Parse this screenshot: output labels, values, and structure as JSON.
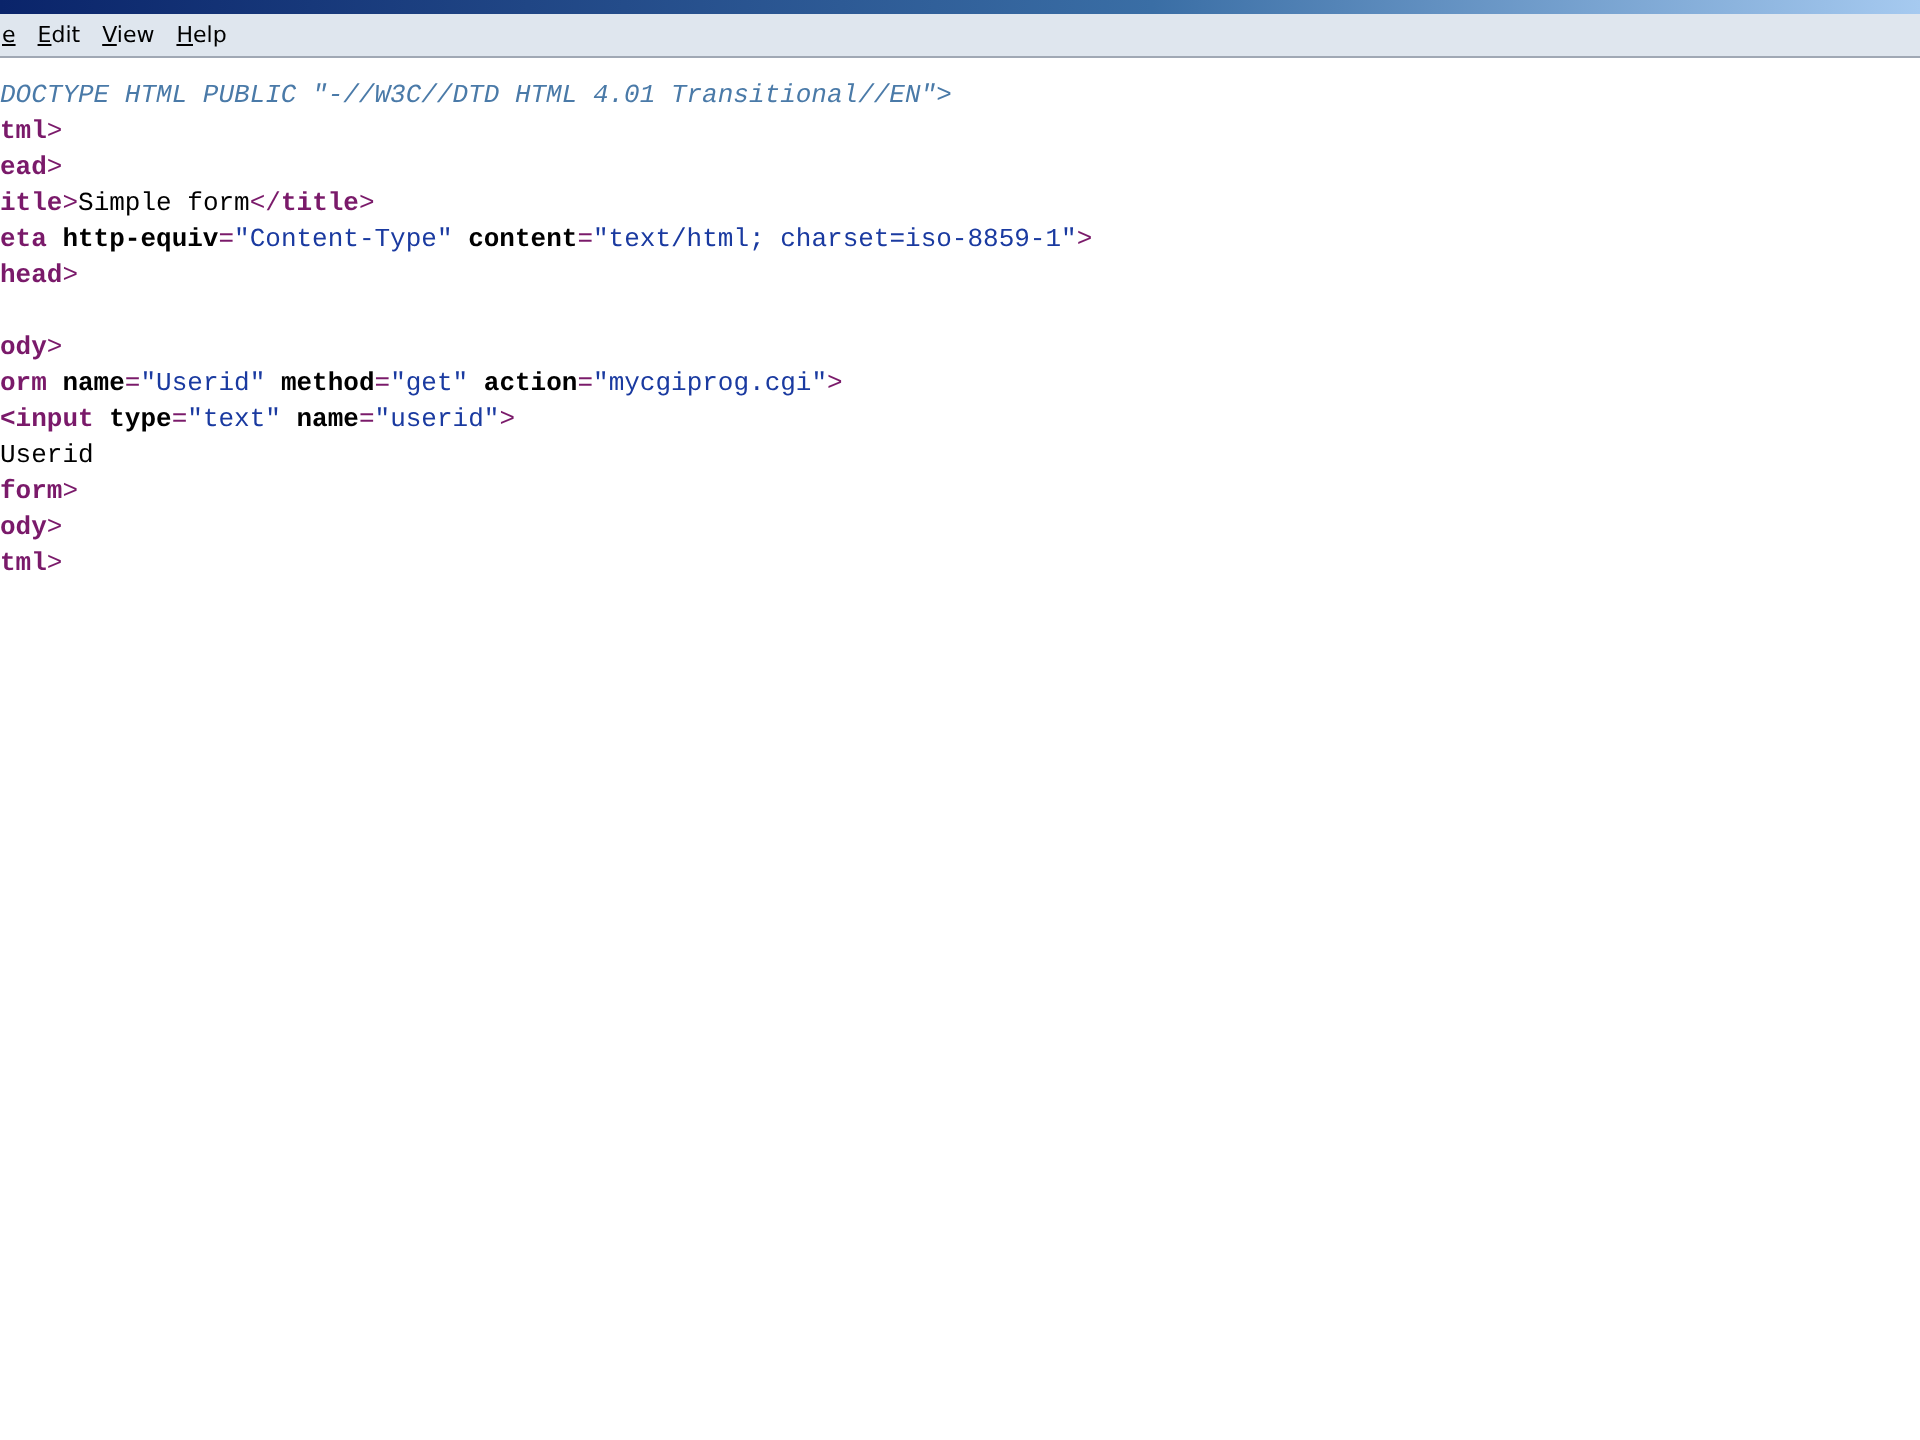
{
  "menu_bar": {
    "items": [
      "e",
      "Edit",
      "View",
      "Help"
    ]
  },
  "source_lines": [
    {
      "kind": "code",
      "tokens": [
        {
          "kind": "doctype",
          "text": "DOCTYPE HTML PUBLIC \"-//W3C//DTD HTML 4.01 Transitional//EN\">"
        }
      ]
    },
    {
      "kind": "code",
      "tokens": [
        {
          "kind": "tag",
          "text": "tml"
        },
        {
          "kind": "punct",
          "text": ">"
        }
      ]
    },
    {
      "kind": "code",
      "tokens": [
        {
          "kind": "tag",
          "text": "ead"
        },
        {
          "kind": "punct",
          "text": ">"
        }
      ]
    },
    {
      "kind": "code",
      "tokens": [
        {
          "kind": "tag",
          "text": "itle"
        },
        {
          "kind": "punct",
          "text": ">"
        },
        {
          "kind": "text",
          "text": "Simple form"
        },
        {
          "kind": "punct",
          "text": "</"
        },
        {
          "kind": "tag",
          "text": "title"
        },
        {
          "kind": "punct",
          "text": ">"
        }
      ]
    },
    {
      "kind": "code",
      "tokens": [
        {
          "kind": "tag",
          "text": "eta"
        },
        {
          "kind": "attr",
          "text": " http-equiv"
        },
        {
          "kind": "punct",
          "text": "="
        },
        {
          "kind": "value",
          "text": "\"Content-Type\""
        },
        {
          "kind": "attr",
          "text": " content"
        },
        {
          "kind": "punct",
          "text": "="
        },
        {
          "kind": "value",
          "text": "\"text/html; charset=iso-8859-1\""
        },
        {
          "kind": "punct",
          "text": ">"
        }
      ]
    },
    {
      "kind": "code",
      "tokens": [
        {
          "kind": "tag",
          "text": "head"
        },
        {
          "kind": "punct",
          "text": ">"
        }
      ]
    },
    {
      "kind": "blank"
    },
    {
      "kind": "code",
      "tokens": [
        {
          "kind": "tag",
          "text": "ody"
        },
        {
          "kind": "punct",
          "text": ">"
        }
      ]
    },
    {
      "kind": "code",
      "tokens": [
        {
          "kind": "tag",
          "text": "orm"
        },
        {
          "kind": "attr",
          "text": " name"
        },
        {
          "kind": "punct",
          "text": "="
        },
        {
          "kind": "value",
          "text": "\"Userid\""
        },
        {
          "kind": "attr",
          "text": " method"
        },
        {
          "kind": "punct",
          "text": "="
        },
        {
          "kind": "value",
          "text": "\"get\""
        },
        {
          "kind": "attr",
          "text": " action"
        },
        {
          "kind": "punct",
          "text": "="
        },
        {
          "kind": "value",
          "text": "\"mycgiprog.cgi\""
        },
        {
          "kind": "punct",
          "text": ">"
        }
      ]
    },
    {
      "kind": "code",
      "tokens": [
        {
          "kind": "tag",
          "text": "<input"
        },
        {
          "kind": "attr",
          "text": " type"
        },
        {
          "kind": "punct",
          "text": "="
        },
        {
          "kind": "value",
          "text": "\"text\""
        },
        {
          "kind": "attr",
          "text": " name"
        },
        {
          "kind": "punct",
          "text": "="
        },
        {
          "kind": "value",
          "text": "\"userid\""
        },
        {
          "kind": "punct",
          "text": ">"
        }
      ]
    },
    {
      "kind": "code",
      "tokens": [
        {
          "kind": "text",
          "text": "Userid"
        }
      ]
    },
    {
      "kind": "code",
      "tokens": [
        {
          "kind": "tag",
          "text": "form"
        },
        {
          "kind": "punct",
          "text": ">"
        }
      ]
    },
    {
      "kind": "code",
      "tokens": [
        {
          "kind": "tag",
          "text": "ody"
        },
        {
          "kind": "punct",
          "text": ">"
        }
      ]
    },
    {
      "kind": "code",
      "tokens": [
        {
          "kind": "tag",
          "text": "tml"
        },
        {
          "kind": "punct",
          "text": ">"
        }
      ]
    }
  ]
}
